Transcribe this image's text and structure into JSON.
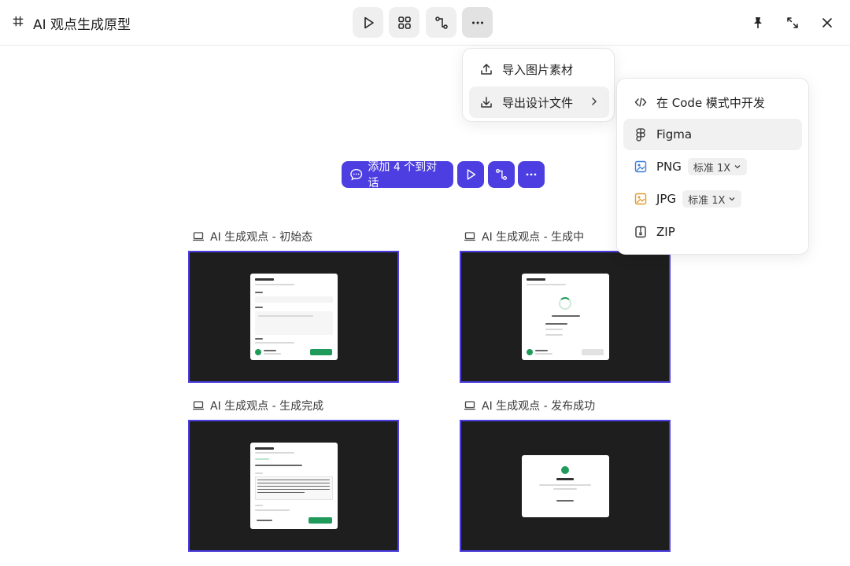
{
  "window": {
    "title": "AI 观点生成原型",
    "title_icon": "hash-icon"
  },
  "toolbar": {
    "buttons": [
      {
        "name": "play",
        "icon": "play-icon"
      },
      {
        "name": "components",
        "icon": "grid-icon"
      },
      {
        "name": "flow",
        "icon": "flow-icon"
      },
      {
        "name": "more",
        "icon": "more-icon",
        "active": true
      }
    ]
  },
  "window_controls": [
    "pin-icon",
    "expand-icon",
    "close-icon"
  ],
  "more_menu": {
    "items": [
      {
        "label": "导入图片素材",
        "icon": "upload-icon"
      },
      {
        "label": "导出设计文件",
        "icon": "download-icon",
        "has_submenu": true,
        "hover": true
      }
    ]
  },
  "export_submenu": {
    "items": [
      {
        "label": "在 Code 模式中开发",
        "icon": "code-icon"
      },
      {
        "label": "Figma",
        "icon": "figma-icon",
        "hover": true
      },
      {
        "label": "PNG",
        "icon": "png-icon",
        "scale": "标准 1X"
      },
      {
        "label": "JPG",
        "icon": "jpg-icon",
        "scale": "标准 1X"
      },
      {
        "label": "ZIP",
        "icon": "zip-icon"
      }
    ]
  },
  "selection_bar": {
    "add_label": "添加 4 个到对话"
  },
  "frames": [
    {
      "label": "AI 生成观点 - 初始态"
    },
    {
      "label": "AI 生成观点 - 生成中"
    },
    {
      "label": "AI 生成观点 - 生成完成"
    },
    {
      "label": "AI 生成观点 - 发布成功"
    }
  ],
  "colors": {
    "accent": "#4c3ee0",
    "frame_bg": "#1e1e1e",
    "success": "#1f9a5b",
    "png_icon": "#3b7ddd",
    "jpg_icon": "#e39a2b"
  }
}
